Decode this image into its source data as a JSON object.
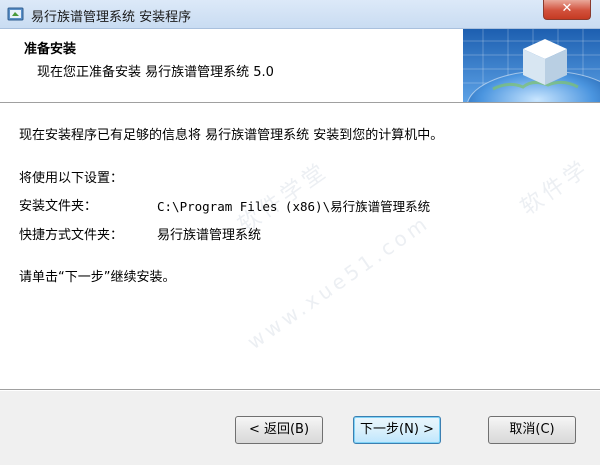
{
  "window": {
    "title": "易行族谱管理系统 安装程序",
    "close_label": "✕"
  },
  "header": {
    "title": "准备安装",
    "subtitle": "现在您正准备安装 易行族谱管理系统 5.0"
  },
  "body": {
    "intro": "现在安装程序已有足够的信息将 易行族谱管理系统 安装到您的计算机中。",
    "settings_heading": "将使用以下设置：",
    "install_folder_label": "安装文件夹：",
    "install_folder_value": "C:\\Program Files (x86)\\易行族谱管理系统",
    "shortcut_folder_label": "快捷方式文件夹：",
    "shortcut_folder_value": "易行族谱管理系统",
    "continue_text": "请单击“下一步”继续安装。"
  },
  "buttons": {
    "back": "< 返回(B)",
    "next": "下一步(N) >",
    "cancel": "取消(C)"
  },
  "watermark": {
    "line1": "软件学堂",
    "line2": "www.xue51.com"
  },
  "icons": {
    "app": "installer-app-icon",
    "header": "globe-cube-graphic"
  }
}
